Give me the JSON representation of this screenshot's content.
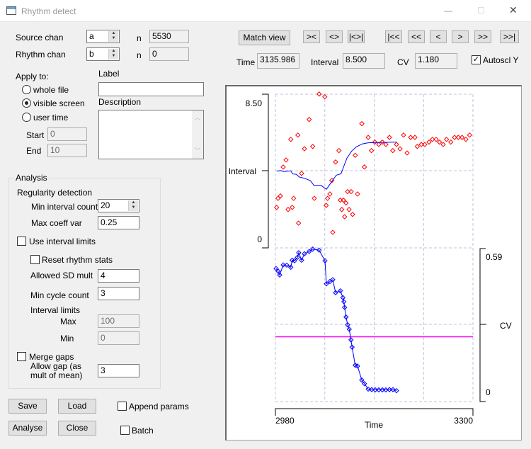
{
  "window": {
    "title": "Rhythm detect",
    "minimize": "—",
    "maximize": "☐",
    "close": "✕"
  },
  "source": {
    "label": "Source chan",
    "value": "a",
    "n_label": "n",
    "n_value": "5530"
  },
  "rhythm": {
    "label": "Rhythm chan",
    "value": "b",
    "n_label": "n",
    "n_value": "0"
  },
  "apply": {
    "label": "Apply to:",
    "options": [
      "whole file",
      "visible screen",
      "user time"
    ],
    "selected": "visible screen",
    "start_label": "Start",
    "start_value": "0",
    "end_label": "End",
    "end_value": "10"
  },
  "label_field": {
    "label": "Label",
    "value": ""
  },
  "description": {
    "label": "Description",
    "value": ""
  },
  "analysis": {
    "title": "Analysis",
    "regularity": "Regularity detection",
    "min_interval_count": {
      "label": "Min interval count",
      "value": "20"
    },
    "max_coeff_var": {
      "label": "Max coeff var",
      "value": "0.25"
    },
    "use_interval_limits": {
      "label": "Use interval limits",
      "checked": false
    },
    "reset_rhythm_stats": {
      "label": "Reset rhythm stats",
      "checked": false
    },
    "allowed_sd_mult": {
      "label": "Allowed SD mult",
      "value": "4"
    },
    "min_cycle_count": {
      "label": "Min cycle count",
      "value": "3"
    },
    "interval_limits": {
      "label": "Interval limits",
      "max_label": "Max",
      "max_value": "100",
      "min_label": "Min",
      "min_value": "0"
    },
    "merge_gaps": {
      "label": "Merge gaps",
      "checked": false
    },
    "allow_gap": {
      "label1": "Allow gap (as",
      "label2": "mult of mean)",
      "value": "3"
    }
  },
  "buttons": {
    "save": "Save",
    "load": "Load",
    "analyse": "Analyse",
    "close": "Close",
    "match_view": "Match view"
  },
  "append_params": {
    "label": "Append params",
    "checked": false
  },
  "batch": {
    "label": "Batch",
    "checked": false
  },
  "nav": [
    "><",
    "<>",
    "|<>|",
    "|<<",
    "<<",
    "<",
    ">",
    ">>",
    ">>|"
  ],
  "readout": {
    "time_label": "Time",
    "time": "3135.986",
    "interval_label": "Interval",
    "interval": "8.500",
    "cv_label": "CV",
    "cv": "1.180",
    "autoscale_label": "Autoscl Y",
    "autoscale": true
  },
  "chart_data": {
    "type": "scatter",
    "xlabel": "Time",
    "xlim": [
      2980,
      3300
    ],
    "xticks": [
      "2980",
      "3300"
    ],
    "grid": true,
    "colors": {
      "interval_points": "#ff0000",
      "mean_line": "#0000ff",
      "cv": "#0000ff",
      "threshold": "#ff00ff",
      "grid": "#c0c0e0"
    },
    "panels": [
      {
        "ylabel": "Interval",
        "ylim": [
          0,
          8.5
        ],
        "ytick_top": "8.50",
        "ytick_bottom": "0",
        "intervals": [
          [
            3050.8,
            8.51
          ],
          [
            3060,
            8.36
          ],
          [
            3034.7,
            7.1
          ],
          [
            3016.3,
            6.24
          ],
          [
            3004.9,
            6.0
          ],
          [
            3027,
            5.48
          ],
          [
            3040.4,
            5.61
          ],
          [
            2997.2,
            4.86
          ],
          [
            2992.6,
            4.47
          ],
          [
            3022.4,
            4.12
          ],
          [
            3120,
            6.87
          ],
          [
            3130.3,
            6.11
          ],
          [
            3082.9,
            5.38
          ],
          [
            3077.5,
            4.75
          ],
          [
            3109.3,
            5.12
          ],
          [
            3124.2,
            4.47
          ],
          [
            3135.6,
            5.38
          ],
          [
            3141,
            5.85
          ],
          [
            3147.5,
            5.72
          ],
          [
            3153.2,
            5.85
          ],
          [
            3159,
            5.72
          ],
          [
            3164.7,
            6.11
          ],
          [
            3170.1,
            5.38
          ],
          [
            3176.1,
            5.72
          ],
          [
            3181.9,
            5.48
          ],
          [
            3187.6,
            6.24
          ],
          [
            3193.3,
            5.25
          ],
          [
            3199.1,
            6.11
          ],
          [
            3206,
            6.11
          ],
          [
            3209.8,
            5.61
          ],
          [
            3216.3,
            5.72
          ],
          [
            3222,
            5.72
          ],
          [
            3228.9,
            5.85
          ],
          [
            3234.3,
            6.0
          ],
          [
            3240.4,
            6.0
          ],
          [
            3245.8,
            5.85
          ],
          [
            3251.8,
            5.72
          ],
          [
            3257.2,
            6.0
          ],
          [
            3264.1,
            5.85
          ],
          [
            3270.2,
            6.11
          ],
          [
            3276.3,
            6.11
          ],
          [
            3282.4,
            6.11
          ],
          [
            3288.6,
            6.0
          ],
          [
            3294.6,
            6.24
          ],
          [
            2984.2,
            2.74
          ],
          [
            2988,
            2.87
          ],
          [
            2982,
            2.24
          ],
          [
            3000.5,
            2.12
          ],
          [
            3007.2,
            2.24
          ],
          [
            3009.5,
            2.74
          ],
          [
            3017.5,
            1.37
          ],
          [
            3043,
            2.74
          ],
          [
            3071.4,
            3.73
          ],
          [
            3068.3,
            2.98
          ],
          [
            3064.5,
            2.74
          ],
          [
            3062.2,
            2.35
          ],
          [
            3072.9,
            0.86
          ],
          [
            3085.2,
            2.64
          ],
          [
            3090.1,
            2.64
          ],
          [
            3094.4,
            2.48
          ],
          [
            3087.5,
            2.12
          ],
          [
            3099.3,
            2.12
          ],
          [
            3092.1,
            1.72
          ],
          [
            3105,
            1.85
          ],
          [
            3097,
            3.11
          ],
          [
            3102.7,
            3.11
          ],
          [
            3113,
            2.98
          ]
        ],
        "mean": [
          [
            2982.3,
            4.24
          ],
          [
            2988,
            4.28
          ],
          [
            2993.4,
            4.22
          ],
          [
            3004.9,
            4.26
          ],
          [
            3008,
            4.09
          ],
          [
            3013.6,
            4.07
          ],
          [
            3018.7,
            3.92
          ],
          [
            3027,
            3.85
          ],
          [
            3036.6,
            3.72
          ],
          [
            3042.3,
            3.46
          ],
          [
            3053.8,
            3.46
          ],
          [
            3062.6,
            3.24
          ],
          [
            3071,
            3.65
          ],
          [
            3078.6,
            4.02
          ],
          [
            3086.3,
            4.1
          ],
          [
            3095.8,
            4.96
          ],
          [
            3103.5,
            5.35
          ],
          [
            3111.1,
            5.59
          ],
          [
            3120.7,
            5.75
          ],
          [
            3130.3,
            5.81
          ],
          [
            3176.1,
            5.85
          ]
        ]
      },
      {
        "ylabel": "CV",
        "ylim": [
          0,
          0.59
        ],
        "ytick_top": "0.59",
        "ytick_bottom": "0",
        "threshold": 0.25,
        "cv": [
          [
            2981.1,
            0.513
          ],
          [
            2984.2,
            0.503
          ],
          [
            2986.9,
            0.488
          ],
          [
            2992.6,
            0.527
          ],
          [
            2998.4,
            0.526
          ],
          [
            3004.9,
            0.518
          ],
          [
            3007.2,
            0.545
          ],
          [
            3011,
            0.543
          ],
          [
            3015.6,
            0.556
          ],
          [
            3017.8,
            0.574
          ],
          [
            3022.4,
            0.545
          ],
          [
            3027,
            0.57
          ],
          [
            3034.7,
            0.579
          ],
          [
            3040.4,
            0.588
          ],
          [
            3050.8,
            0.584
          ],
          [
            3060.3,
            0.543
          ],
          [
            3062.6,
            0.454
          ],
          [
            3068.3,
            0.463
          ],
          [
            3072.9,
            0.47
          ],
          [
            3077.5,
            0.42
          ],
          [
            3085.2,
            0.427
          ],
          [
            3089.3,
            0.401
          ],
          [
            3090.9,
            0.385
          ],
          [
            3092.1,
            0.363
          ],
          [
            3094.4,
            0.326
          ],
          [
            3097,
            0.296
          ],
          [
            3099.6,
            0.279
          ],
          [
            3102.4,
            0.238
          ],
          [
            3104.2,
            0.21
          ],
          [
            3109.3,
            0.14
          ],
          [
            3113,
            0.137
          ],
          [
            3119.9,
            0.083
          ],
          [
            3124.2,
            0.069
          ],
          [
            3130.3,
            0.048
          ],
          [
            3136,
            0.046
          ],
          [
            3141.7,
            0.045
          ],
          [
            3147.5,
            0.045
          ],
          [
            3153.2,
            0.045
          ],
          [
            3158.9,
            0.045
          ],
          [
            3164.7,
            0.046
          ],
          [
            3170.4,
            0.046
          ],
          [
            3176.1,
            0.042
          ]
        ]
      }
    ]
  }
}
